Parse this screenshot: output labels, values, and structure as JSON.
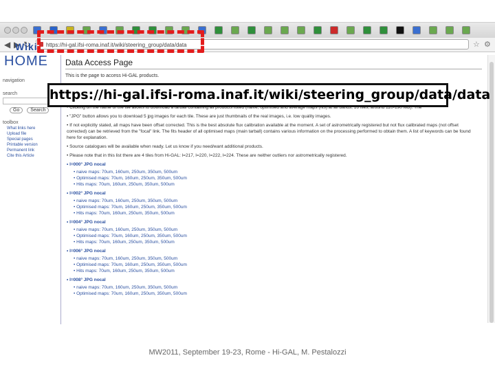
{
  "browser": {
    "url": "https://hi-gal.ifsi-roma.inaf.it/wiki/steering_group/data/data",
    "tabs": [
      {
        "color": "#3a6fd0"
      },
      {
        "color": "#2b63c9"
      },
      {
        "color": "#c8b31e"
      },
      {
        "color": "#67a64d"
      },
      {
        "color": "#3a6fd0"
      },
      {
        "color": "#67a64d"
      },
      {
        "color": "#2f8f3b"
      },
      {
        "color": "#2f8f3b"
      },
      {
        "color": "#6aa84f"
      },
      {
        "color": "#6aa84f"
      },
      {
        "color": "#3a6fd0"
      },
      {
        "color": "#2f8f3b"
      },
      {
        "color": "#6aa84f"
      },
      {
        "color": "#2f8f3b"
      },
      {
        "color": "#6aa84f"
      },
      {
        "color": "#6aa84f"
      },
      {
        "color": "#6aa84f"
      },
      {
        "color": "#2f8f3b"
      },
      {
        "color": "#cc2a2a"
      },
      {
        "color": "#6aa84f"
      },
      {
        "color": "#2f8f3b"
      },
      {
        "color": "#2f8f3b"
      },
      {
        "color": "#111111"
      },
      {
        "color": "#3a6fd0"
      },
      {
        "color": "#6aa84f"
      },
      {
        "color": "#6aa84f"
      },
      {
        "color": "#6aa84f"
      }
    ]
  },
  "sidebar": {
    "logo_top": "Wiki",
    "logo_bottom": "HOME",
    "nav_heading": "navigation",
    "search_heading": "search",
    "go_label": "Go",
    "search_label": "Search",
    "toolbox_heading": "toolbox",
    "toolbox_links": [
      "What links here",
      "Upload file",
      "Special pages",
      "Printable version",
      "Permanent link",
      "Cite this Article"
    ]
  },
  "page": {
    "title": "Data Access Page",
    "intro": "This is the page to access Hi-GAL products.",
    "bullets": [
      "Clicking on the name of the tile allows to download a tarball containing all products listed (naive, optimised and average maps (fits) at all bands, 16 files, around 120-190 MB). The",
      "\"JPG\" button allows you to download 5 jpg images for each tile. These are just thumbnails of the real images, i.e. low quality images.",
      "If not explicitly stated, all maps have been offset corrected. This is the best absolute flux calibration available at the moment. A set of astrometrically registered but not flux calibrated maps (not offset corrected) can be retrieved from the \"focal\" link. The fits header of all optimised maps (main tarball) contains various information on the processing performed to obtain them. A list of keywords can be found here for explanation.",
      "Source catalogues will be available when ready. Let us know if you need/want additional products.",
      "Please note that in this list there are 4 tiles from Hi-GAL: l=217, l=220, l=222, l=224. These are neither outliers nor astrometrically registered."
    ],
    "sections": [
      {
        "name": "l=000° JPG nocal",
        "items": [
          "naive maps: 70um, 160um, 250um, 350um, 500um",
          "Optimised maps: 70um, 160um, 250um, 350um, 500um",
          "Hits maps: 70um, 160um, 250um, 350um, 500um"
        ]
      },
      {
        "name": "l=002° JPG nocal",
        "items": [
          "naive maps: 70um, 160um, 250um, 350um, 500um",
          "Optimised maps: 70um, 160um, 250um, 350um, 500um",
          "Hits maps: 70um, 160um, 250um, 350um, 500um"
        ]
      },
      {
        "name": "l=004° JPG nocal",
        "items": [
          "naive maps: 70um, 160um, 250um, 350um, 500um",
          "Optimised maps: 70um, 160um, 250um, 350um, 500um",
          "Hits maps: 70um, 160um, 250um, 350um, 500um"
        ]
      },
      {
        "name": "l=006° JPG nocal",
        "items": [
          "naive maps: 70um, 160um, 250um, 350um, 500um",
          "Optimised maps: 70um, 160um, 250um, 350um, 500um",
          "Hits maps: 70um, 160um, 250um, 350um, 500um"
        ]
      },
      {
        "name": "l=008° JPG nocal",
        "items": [
          "naive maps: 70um, 160um, 250um, 350um, 500um",
          "Optimised maps: 70um, 160um, 250um, 350um, 500um"
        ]
      }
    ]
  },
  "overlay_url": "https://hi-gal.ifsi-roma.inaf.it/wiki/steering_group/data/data",
  "footer": "MW2011, September 19-23, Rome - Hi-GAL, M. Pestalozzi",
  "colors": {
    "highlight": "#e31c1c",
    "link": "#2a4fa0"
  }
}
